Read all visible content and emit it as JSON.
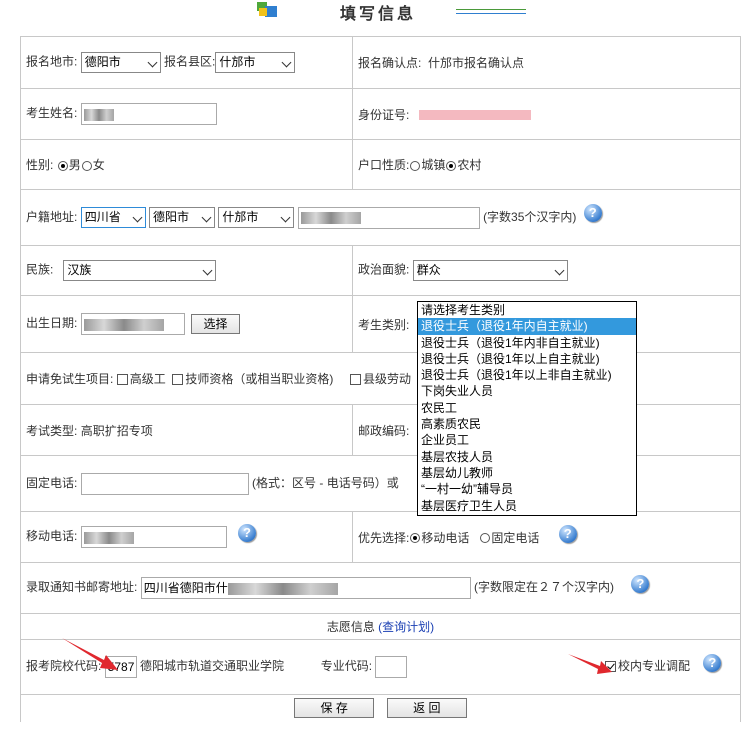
{
  "header": {
    "title": "填写信息"
  },
  "rows": {
    "area": {
      "city_label": "报名地市:",
      "city_value": "德阳市",
      "county_label": "报名县区:",
      "county_value": "什邡市",
      "confirm_label": "报名确认点:",
      "confirm_value": "什邡市报名确认点"
    },
    "name": {
      "label": "考生姓名:",
      "id_label": "身份证号:"
    },
    "gender": {
      "label": "性别:",
      "male": "男",
      "female": "女",
      "hukou_label": "户口性质:",
      "urban": "城镇",
      "rural": "农村"
    },
    "address": {
      "label": "户籍地址:",
      "province": "四川省",
      "city": "德阳市",
      "county": "什邡市",
      "hint": "(字数35个汉字内)"
    },
    "ethnic": {
      "label": "民族:",
      "value": "汉族",
      "politics_label": "政治面貌:",
      "politics_value": "群众"
    },
    "birth": {
      "label": "出生日期:",
      "choose_button": "选择",
      "category_label": "考生类别:"
    },
    "exempt": {
      "label": "申请免试生项目:",
      "opt1": "高级工",
      "opt2": "技师资格（或相当职业资格)",
      "opt3": "县级劳动"
    },
    "exam": {
      "label": "考试类型:",
      "value": "高职扩招专项",
      "postal_label": "邮政编码:"
    },
    "phone": {
      "label": "固定电话:",
      "hint": "(格式：区号 - 电话号码）或"
    },
    "mobile": {
      "label": "移动电话:",
      "priority_label": "优先选择:",
      "mobile_opt": "移动电话",
      "fixed_opt": "固定电话"
    },
    "mail": {
      "label": "录取通知书邮寄地址:",
      "value": "四川省德阳市什",
      "hint": "(字数限定在２７个汉字内)"
    },
    "wish": {
      "label": "志愿信息",
      "link": "(查询计划)"
    },
    "school": {
      "code_label": "报考院校代码:",
      "code_value": "5787",
      "name": "德阳城市轨道交通职业学院",
      "major_label": "专业代码:",
      "adjust_label": "校内专业调配"
    }
  },
  "buttons": {
    "save": "保 存",
    "back": "返 回"
  },
  "dropdown": {
    "options": [
      "请选择考生类别",
      "退役士兵（退役1年内自主就业)",
      "退役士兵（退役1年内非自主就业)",
      "退役士兵（退役1年以上自主就业)",
      "退役士兵（退役1年以上非自主就业)",
      "下岗失业人员",
      "农民工",
      "高素质农民",
      "企业员工",
      "基层农技人员",
      "基层幼儿教师",
      "“一村一幼”辅导员",
      "基层医疗卫生人员"
    ],
    "selected_index": 1
  },
  "colors": {
    "selected_option": "#3399dd",
    "link": "#1a3fb3",
    "arrow": "#e0282e"
  }
}
